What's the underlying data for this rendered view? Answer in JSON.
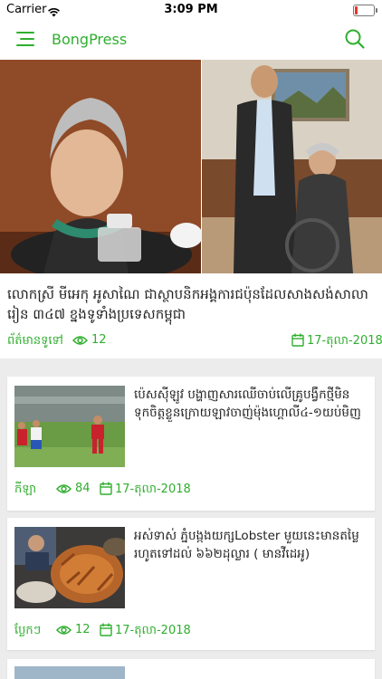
{
  "status_bar": {
    "carrier": "Carrier",
    "time": "3:09 PM"
  },
  "header": {
    "title": "BongPress"
  },
  "featured": {
    "title": "លោកស្រី មីអេកុ អូសាណៃ ជាស្ថាបនិកអង្គការជប៉ុនដែលសាងសង់សាលារៀន ៣៤៧ ខ្នងទូទាំងប្រទេសកម្ពុជា",
    "category": "ព័ត៌មានទូទៅ",
    "views": "12",
    "date": "17-តុលា-2018"
  },
  "articles": [
    {
      "title": "ប៉េសស៊ីឡូវ បង្ហាញសារឈើចាប់លើគ្រូបង្វឹកថ្មីមិនទុកចិត្តខ្លួនក្រោយឡាវចាញ់ម៉ុងហ្គោលី៤-១យប់មិញ",
      "category": "កីឡា",
      "views": "84",
      "date": "17-តុលា-2018"
    },
    {
      "title": "អស់ទាស់ ភ្នំបង្កងយក្សLobster មួយនេះមានតម្លៃរហូតទៅដល់ ៦៦២ដុល្លារ ( មានវីដេអូ)",
      "category": "ប្លែកៗ",
      "views": "12",
      "date": "17-តុលា-2018"
    }
  ],
  "colors": {
    "accent": "#2fae2f",
    "battery": "#e5352b"
  }
}
